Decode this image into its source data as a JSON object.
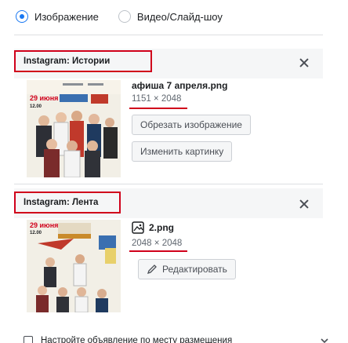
{
  "format": {
    "options": [
      {
        "label": "Изображение",
        "selected": true
      },
      {
        "label": "Видео/Слайд-шоу",
        "selected": false
      }
    ]
  },
  "placements": [
    {
      "title": "Instagram: Истории",
      "filename": "афиша 7 апреля.png",
      "dimensions": "1151 × 2048",
      "buttons": [
        "Обрезать изображение",
        "Изменить картинку"
      ],
      "poster_text": [
        "29 июня",
        "12.00"
      ]
    },
    {
      "title": "Instagram: Лента",
      "filename": "2.png",
      "dimensions": "2048 × 2048",
      "buttons": [
        "Редактировать"
      ],
      "poster_text": [
        "29 июня",
        "12.00"
      ]
    }
  ],
  "footer": {
    "label": "Настройте объявление по месту размещения"
  },
  "colors": {
    "accent": "#1877f2",
    "highlight": "#d0011b"
  }
}
